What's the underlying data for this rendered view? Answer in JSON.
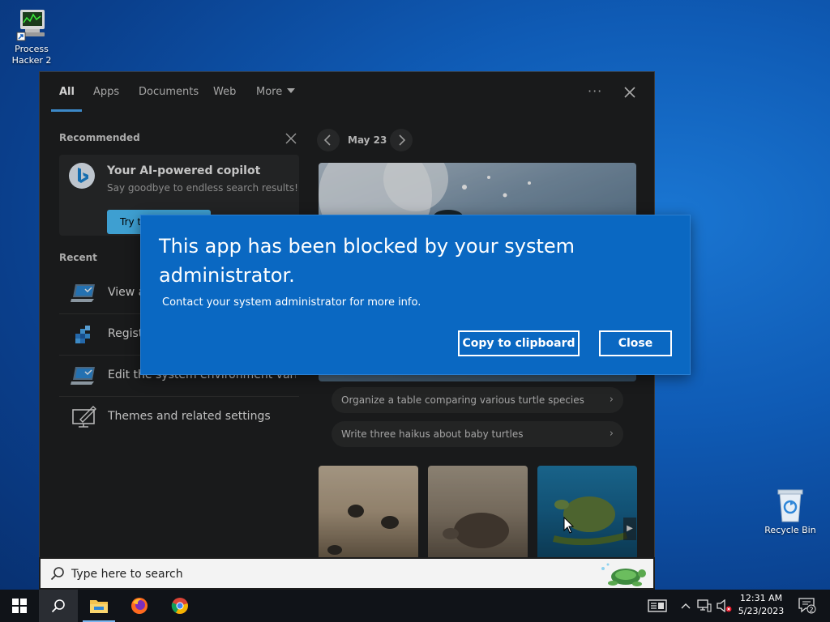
{
  "desktop": {
    "icons": [
      {
        "label": "Process\nHacker 2",
        "label_line1": "Process",
        "label_line2": "Hacker 2",
        "icon": "process-hacker-icon"
      },
      {
        "label": "Recycle Bin",
        "icon": "recycle-bin-icon"
      }
    ]
  },
  "search_panel": {
    "tabs": [
      {
        "label": "All",
        "active": true
      },
      {
        "label": "Apps"
      },
      {
        "label": "Documents"
      },
      {
        "label": "Web"
      },
      {
        "label": "More"
      }
    ],
    "more_icon": "chevron-down-icon",
    "options_label": "···",
    "recommended": {
      "title": "Recommended",
      "card": {
        "title": "Your AI-powered copilot",
        "subtitle": "Say goodbye to endless search results!",
        "button": "Try t",
        "icon": "bing-icon"
      }
    },
    "recent": {
      "title": "Recent",
      "items": [
        {
          "label": "View a",
          "icon": "laptop-icon"
        },
        {
          "label": "Regist",
          "icon": "registry-icon"
        },
        {
          "label": "Edit the system environment vari...",
          "icon": "laptop-icon"
        },
        {
          "label": "Themes and related settings",
          "icon": "themes-icon"
        }
      ]
    },
    "date_label": "May 23",
    "prompts": [
      "Organize a table comparing various turtle species",
      "Write three haikus about baby turtles"
    ],
    "search_box": {
      "placeholder": "Type here to search"
    }
  },
  "dialog": {
    "title": "This app has been blocked by your system administrator.",
    "message": "Contact your system administrator for more info.",
    "copy_button": "Copy to clipboard",
    "close_button": "Close"
  },
  "taskbar": {
    "apps": [
      "windows-start-icon",
      "search-icon",
      "file-explorer-icon",
      "firefox-icon",
      "chrome-icon"
    ],
    "clock_time": "12:31 AM",
    "clock_date": "5/23/2023",
    "notification_count": "2"
  },
  "colors": {
    "dialog_bg": "#0a68c2",
    "accent": "#4cc2ff",
    "panel_bg": "#1f2021",
    "taskbar_bg": "#101318"
  }
}
